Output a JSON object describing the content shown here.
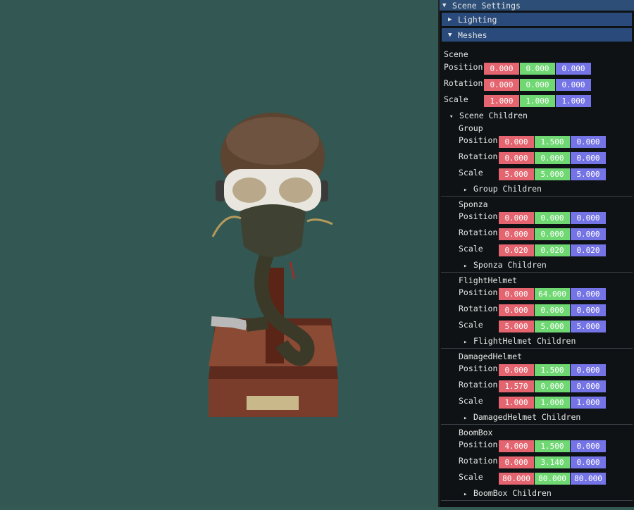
{
  "panel": {
    "title": "Scene Settings",
    "sections": {
      "lighting": "Lighting",
      "meshes": "Meshes"
    },
    "scene": {
      "label": "Scene",
      "position": [
        "0.000",
        "0.000",
        "0.000"
      ],
      "rotation": [
        "0.000",
        "0.000",
        "0.000"
      ],
      "scale": [
        "1.000",
        "1.000",
        "1.000"
      ],
      "children_label": "Scene Children"
    },
    "field_labels": {
      "position": "Position",
      "rotation": "Rotation",
      "scale": "Scale"
    },
    "children": [
      {
        "name": "Group",
        "position": [
          "0.000",
          "1.500",
          "0.000"
        ],
        "rotation": [
          "0.000",
          "0.000",
          "0.000"
        ],
        "scale": [
          "5.000",
          "5.000",
          "5.000"
        ],
        "children_label": "Group Children"
      },
      {
        "name": "Sponza",
        "position": [
          "0.000",
          "0.000",
          "0.000"
        ],
        "rotation": [
          "0.000",
          "0.000",
          "0.000"
        ],
        "scale": [
          "0.020",
          "0.020",
          "0.020"
        ],
        "children_label": "Sponza Children"
      },
      {
        "name": "FlightHelmet",
        "position": [
          "0.000",
          "64.000",
          "0.000"
        ],
        "rotation": [
          "0.000",
          "0.000",
          "0.000"
        ],
        "scale": [
          "5.000",
          "5.000",
          "5.000"
        ],
        "children_label": "FlightHelmet Children"
      },
      {
        "name": "DamagedHelmet",
        "position": [
          "0.000",
          "1.500",
          "0.000"
        ],
        "rotation": [
          "1.570",
          "0.000",
          "0.000"
        ],
        "scale": [
          "1.000",
          "1.000",
          "1.000"
        ],
        "children_label": "DamagedHelmet Children"
      },
      {
        "name": "BoomBox",
        "position": [
          "4.000",
          "1.500",
          "0.000"
        ],
        "rotation": [
          "0.000",
          "3.140",
          "0.000"
        ],
        "scale": [
          "80.000",
          "80.000",
          "80.000"
        ],
        "children_label": "BoomBox Children"
      }
    ]
  },
  "colors": {
    "x": "#e4656f",
    "y": "#6fd872",
    "z": "#7474e6",
    "header": "#294a7a",
    "background": "#335752"
  }
}
